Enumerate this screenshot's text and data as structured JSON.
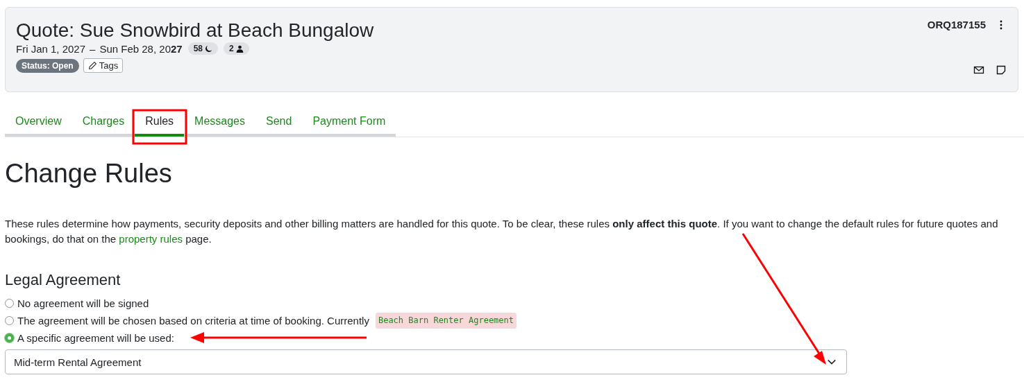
{
  "header": {
    "title": "Quote: Sue Snowbird at Beach Bungalow",
    "start_date": "Fri Jan 1, 2027",
    "dash": "–",
    "end_date": "Sun Feb 28, 20**27**",
    "nights": "58",
    "guests": "2",
    "status": "Status: Open",
    "tags_button": "Tags",
    "reference": "ORQ187155"
  },
  "tabs": [
    {
      "label": "Overview",
      "selected": false
    },
    {
      "label": "Charges",
      "selected": false
    },
    {
      "label": "Rules",
      "selected": true
    },
    {
      "label": "Messages",
      "selected": false
    },
    {
      "label": "Send",
      "selected": false
    },
    {
      "label": "Payment Form",
      "selected": false
    }
  ],
  "heading": "Change Rules",
  "intro": {
    "before": "These rules determine how payments, security deposits and other billing matters are handled for this quote.  To be clear, these rules **only affect this quote**.  If you want to change the default rules for future quotes and bookings, do that on the",
    "link": "property rules",
    "after": "page."
  },
  "legal": {
    "title": "Legal Agreement",
    "options": [
      {
        "label": "No agreement will be signed",
        "selected": false
      },
      {
        "label": "The agreement will be chosen based on criteria at time of booking. Currently",
        "tag": "Beach Barn Renter Agreement",
        "selected": false
      },
      {
        "label": "A specific agreement will be used:",
        "selected": true
      }
    ],
    "select_value": "Mid-term Rental Agreement"
  }
}
